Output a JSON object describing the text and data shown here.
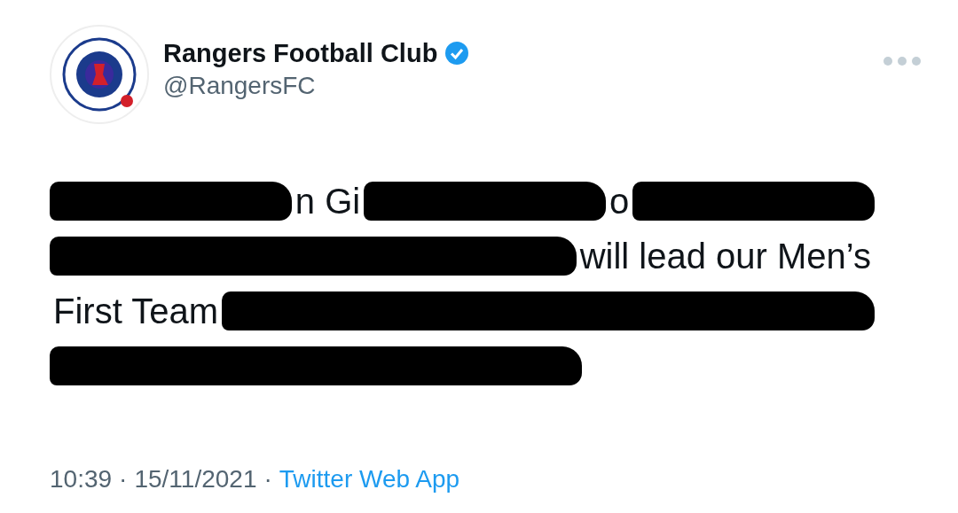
{
  "tweet": {
    "author": {
      "name": "Rangers Football Club",
      "handle": "@RangersFC",
      "verified": true
    },
    "lines": [
      [
        {
          "kind": "redacted"
        },
        {
          "kind": "text",
          "text": "n Gi"
        },
        {
          "kind": "redacted"
        },
        {
          "kind": "text",
          "text": "o"
        },
        {
          "kind": "redacted"
        }
      ],
      [
        {
          "kind": "redacted"
        },
        {
          "kind": "text",
          "text": "will lead our Men’s"
        }
      ],
      [
        {
          "kind": "text",
          "text": "First Team"
        },
        {
          "kind": "redacted"
        }
      ],
      [
        {
          "kind": "redacted"
        }
      ]
    ],
    "footer": [
      {
        "kind": "time",
        "text": "10:39"
      },
      {
        "kind": "separator",
        "text": "·"
      },
      {
        "kind": "date",
        "text": "15/11/2021"
      },
      {
        "kind": "separator",
        "text": "·"
      },
      {
        "kind": "source",
        "text": "Twitter Web App"
      }
    ]
  }
}
